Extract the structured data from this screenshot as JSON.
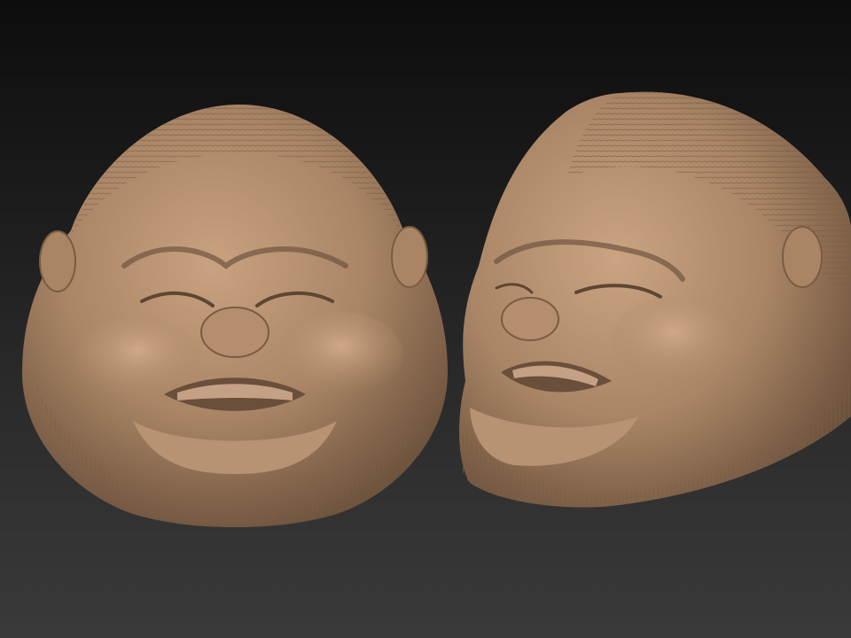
{
  "scene": {
    "subject": "sculpted-heads",
    "background_colors": {
      "top": "#0d0d0d",
      "bottom": "#3a3a3a"
    },
    "material_color": "#a98566",
    "heads": [
      {
        "view": "front"
      },
      {
        "view": "three-quarter"
      }
    ]
  }
}
